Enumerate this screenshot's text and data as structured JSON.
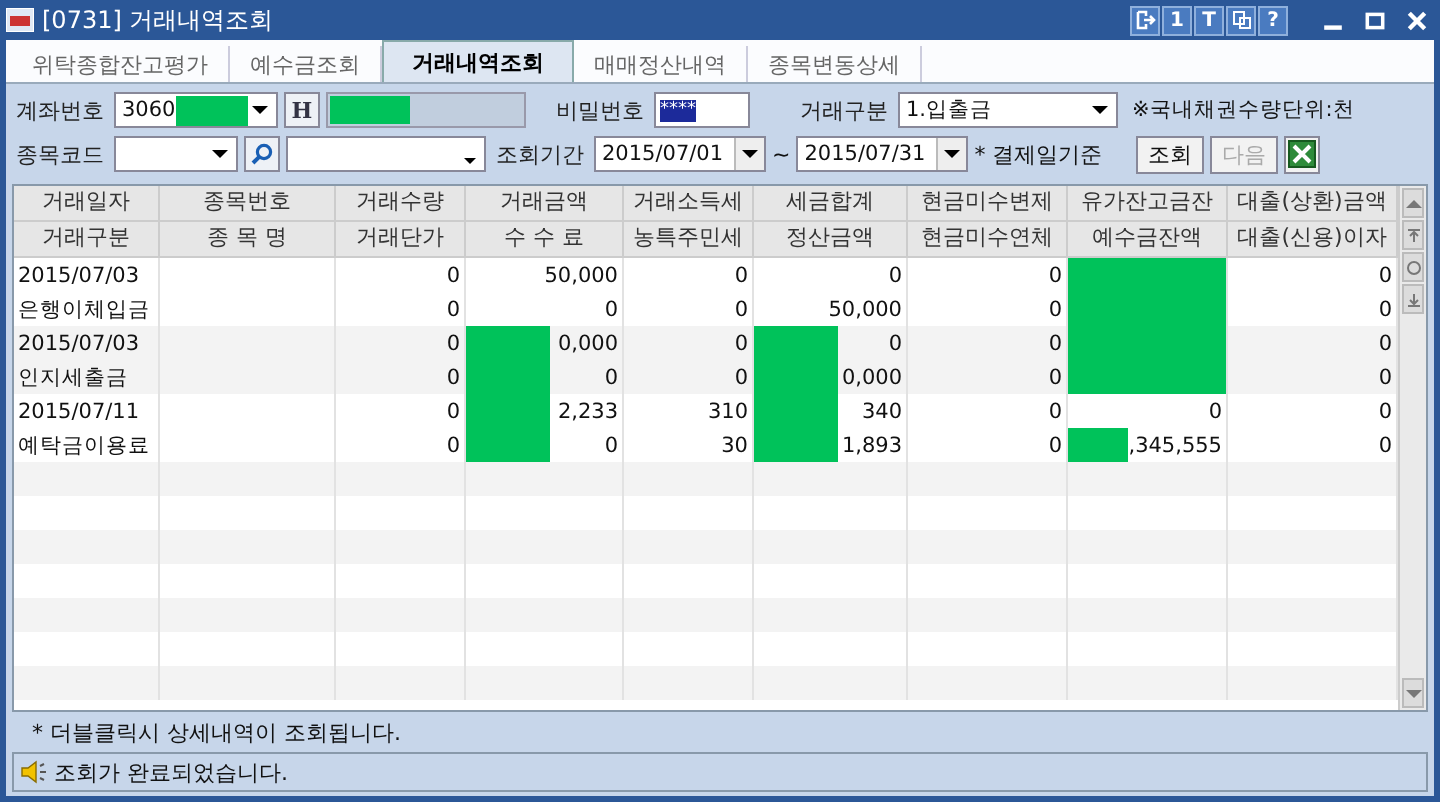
{
  "window": {
    "title": "[0731] 거래내역조회",
    "tools": [
      {
        "kind": "exit"
      },
      {
        "kind": "text",
        "label": "1"
      },
      {
        "kind": "text",
        "label": "T"
      },
      {
        "kind": "copy"
      },
      {
        "kind": "text",
        "label": "?"
      }
    ]
  },
  "tabs": [
    {
      "label": "위탁종합잔고평가",
      "selected": false
    },
    {
      "label": "예수금조회",
      "selected": false
    },
    {
      "label": "거래내역조회",
      "selected": true
    },
    {
      "label": "매매정산내역",
      "selected": false
    },
    {
      "label": "종목변동상세",
      "selected": false
    }
  ],
  "form": {
    "account_label": "계좌번호",
    "account_value": "3060",
    "account_masked": true,
    "h_button": "H",
    "name_masked": true,
    "password_label": "비밀번호",
    "password_value": "****",
    "type_label": "거래구분",
    "type_value": "1.입출금",
    "unit_note": "※국내채권수량단위:천",
    "code_label": "종목코드",
    "period_label": "조회기간",
    "date_from": "2015/07/01",
    "tilde": "~",
    "date_to": "2015/07/31",
    "basis_note": "* 결제일기준",
    "search_button": "조회",
    "next_button": {
      "label": "다음",
      "disabled": true
    }
  },
  "table": {
    "header_rows": [
      [
        "거래일자",
        "종목번호",
        "거래수량",
        "거래금액",
        "거래소득세",
        "세금합계",
        "현금미수변제",
        "유가잔고금잔",
        "대출(상환)금액"
      ],
      [
        "거래구분",
        "종 목 명",
        "거래단가",
        "수  수  료",
        "농특주민세",
        "정산금액",
        "현금미수연체",
        "예수금잔액",
        "대출(신용)이자"
      ]
    ],
    "rows": [
      [
        {
          "text": "2015/07/03",
          "masked": false
        },
        {},
        {
          "text": "0",
          "masked": false
        },
        {
          "text": "50,000",
          "masked": false
        },
        {
          "text": "0",
          "masked": false
        },
        {
          "text": "0",
          "masked": false
        },
        {
          "text": "0",
          "masked": false
        },
        {
          "masked": true
        },
        {
          "text": "0",
          "masked": false
        }
      ],
      [
        {
          "text": "은행이체입금",
          "masked": false
        },
        {},
        {
          "text": "0",
          "masked": false
        },
        {
          "text": "0",
          "masked": false
        },
        {
          "text": "0",
          "masked": false
        },
        {
          "text": "50,000",
          "masked": false
        },
        {
          "text": "0",
          "masked": false
        },
        {
          "masked": true
        },
        {
          "text": "0",
          "masked": false
        }
      ],
      [
        {
          "text": "2015/07/03",
          "masked": false
        },
        {},
        {
          "text": "0",
          "masked": false
        },
        {
          "text": "0,000",
          "masked": true
        },
        {
          "text": "0",
          "masked": false
        },
        {
          "text": "0",
          "masked": true
        },
        {
          "text": "0",
          "masked": false
        },
        {
          "masked": true
        },
        {
          "text": "0",
          "masked": false
        }
      ],
      [
        {
          "text": "인지세출금",
          "masked": false
        },
        {},
        {
          "text": "0",
          "masked": false
        },
        {
          "text": "0",
          "masked": true
        },
        {
          "text": "0",
          "masked": false
        },
        {
          "text": "0,000",
          "masked": true
        },
        {
          "text": "0",
          "masked": false
        },
        {
          "masked": true
        },
        {
          "text": "0",
          "masked": false
        }
      ],
      [
        {
          "text": "2015/07/11",
          "masked": false
        },
        {},
        {
          "text": "0",
          "masked": false
        },
        {
          "text": "2,233",
          "masked": true
        },
        {
          "text": "310",
          "masked": false
        },
        {
          "text": "340",
          "masked": true
        },
        {
          "text": "0",
          "masked": false
        },
        {
          "text": "0",
          "masked": false
        },
        {
          "text": "0",
          "masked": false
        }
      ],
      [
        {
          "text": "예탁금이용료",
          "masked": false
        },
        {},
        {
          "text": "0",
          "masked": false
        },
        {
          "text": "0",
          "masked": true
        },
        {
          "text": "30",
          "masked": false
        },
        {
          "text": "1,893",
          "masked": true
        },
        {
          "text": "0",
          "masked": false
        },
        {
          "text": ",345,555",
          "masked": true
        },
        {
          "text": "0",
          "masked": false
        }
      ]
    ]
  },
  "footer_note": "* 더블클릭시 상세내역이 조회됩니다.",
  "status": "조회가 완료되었습니다."
}
